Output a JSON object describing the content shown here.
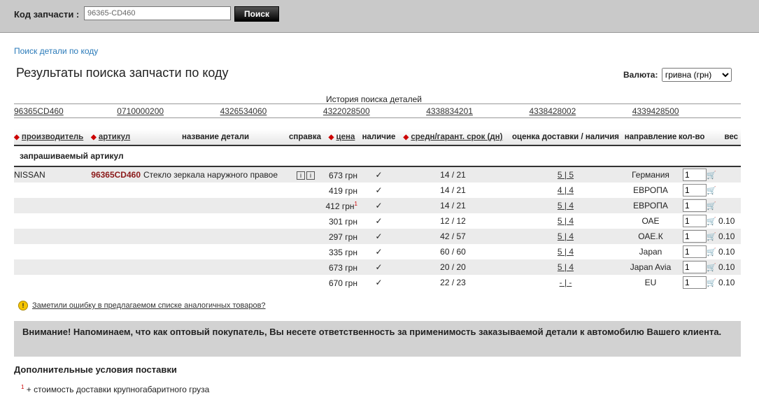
{
  "search": {
    "label": "Код запчасти :",
    "value": "96365-CD460",
    "button": "Поиск"
  },
  "link_search": "Поиск детали по коду",
  "title": "Результаты поиска запчасти по коду",
  "currency": {
    "label": "Валюта:",
    "selected": "гривна (грн)"
  },
  "history": {
    "title": "История поиска деталей",
    "items": [
      "96365CD460",
      "0710000200",
      "4326534060",
      "4322028500",
      "4338834201",
      "4338428002",
      "4339428500"
    ]
  },
  "columns": {
    "maker": "производитель",
    "article": "артикул",
    "name": "название детали",
    "info": "справка",
    "price": "цена",
    "avail": "наличие",
    "term": "средн/гарант. срок (дн)",
    "rating": "оценка доставки / наличия",
    "direction": "направление",
    "qty": "кол-во",
    "weight": "вес"
  },
  "section": "запрашиваемый артикул",
  "rows": [
    {
      "maker": "NISSAN",
      "article": "96365CD460",
      "name": "Стекло зеркала наружного правое",
      "price": "673 грн",
      "sup": "",
      "avail": "✓",
      "term": "14 / 21",
      "rating": "5 | 5",
      "direction": "Германия",
      "qty": "1",
      "weight": ""
    },
    {
      "maker": "",
      "article": "",
      "name": "",
      "price": "419 грн",
      "sup": "",
      "avail": "✓",
      "term": "14 / 21",
      "rating": "4 | 4",
      "direction": "ЕВРОПА",
      "qty": "1",
      "weight": ""
    },
    {
      "maker": "",
      "article": "",
      "name": "",
      "price": "412 грн",
      "sup": "1",
      "avail": "✓",
      "term": "14 / 21",
      "rating": "5 | 4",
      "direction": "ЕВРОПА",
      "qty": "1",
      "weight": ""
    },
    {
      "maker": "",
      "article": "",
      "name": "",
      "price": "301 грн",
      "sup": "",
      "avail": "✓",
      "term": "12 / 12",
      "rating": "5 | 4",
      "direction": "ОАЕ",
      "qty": "1",
      "weight": "0.10"
    },
    {
      "maker": "",
      "article": "",
      "name": "",
      "price": "297 грн",
      "sup": "",
      "avail": "✓",
      "term": "42 / 57",
      "rating": "5 | 4",
      "direction": "ОАЕ.К",
      "qty": "1",
      "weight": "0.10"
    },
    {
      "maker": "",
      "article": "",
      "name": "",
      "price": "335 грн",
      "sup": "",
      "avail": "✓",
      "term": "60 / 60",
      "rating": "5 | 4",
      "direction": "Japan",
      "qty": "1",
      "weight": "0.10"
    },
    {
      "maker": "",
      "article": "",
      "name": "",
      "price": "673 грн",
      "sup": "",
      "avail": "✓",
      "term": "20 / 20",
      "rating": "5 | 4",
      "direction": "Japan Avia",
      "qty": "1",
      "weight": "0.10"
    },
    {
      "maker": "",
      "article": "",
      "name": "",
      "price": "670 грн",
      "sup": "",
      "avail": "✓",
      "term": "22 / 23",
      "rating": "- | -",
      "direction": "EU",
      "qty": "1",
      "weight": "0.10"
    }
  ],
  "error_link": "Заметили ошибку в предлагаемом списке аналогичных товаров?",
  "warning": "Внимание! Напоминаем, что как оптовый покупатель, Вы несете ответственность за применимость заказываемой детали к автомобилю Вашего клиента.",
  "conditions_title": "Дополнительные условия поставки",
  "footnote": {
    "mark": "1",
    "text": "+ стоимость доставки крупногабаритного груза"
  }
}
